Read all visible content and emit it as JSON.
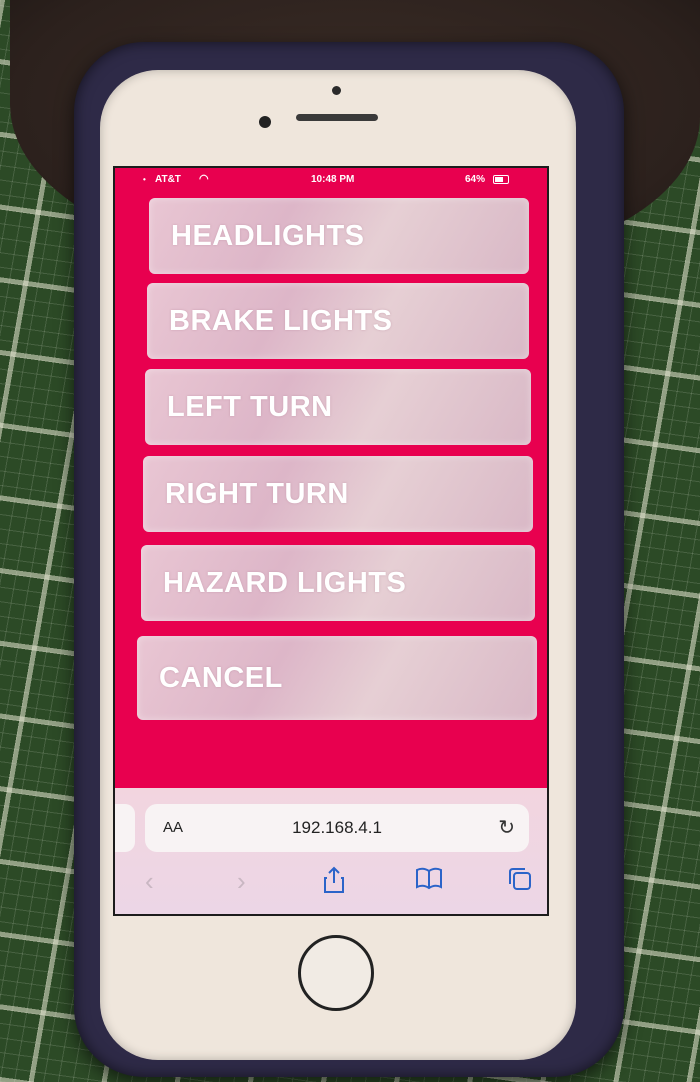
{
  "status_bar": {
    "carrier": "AT&T",
    "time": "10:48 PM",
    "battery": "64%"
  },
  "menu": {
    "buttons": [
      {
        "label": "HEADLIGHTS"
      },
      {
        "label": "BRAKE LIGHTS"
      },
      {
        "label": "LEFT TURN"
      },
      {
        "label": "RIGHT TURN"
      },
      {
        "label": "HAZARD LIGHTS"
      },
      {
        "label": "CANCEL"
      }
    ]
  },
  "browser": {
    "text_size_label": "AA",
    "url": "192.168.4.1",
    "icons": [
      "reload-icon",
      "back-icon",
      "forward-icon",
      "share-icon",
      "bookmarks-icon",
      "tabs-icon"
    ]
  },
  "colors": {
    "page_background": "#e8004f",
    "button_text": "#ffffff",
    "toolbar_icon": "#2b64c9"
  }
}
